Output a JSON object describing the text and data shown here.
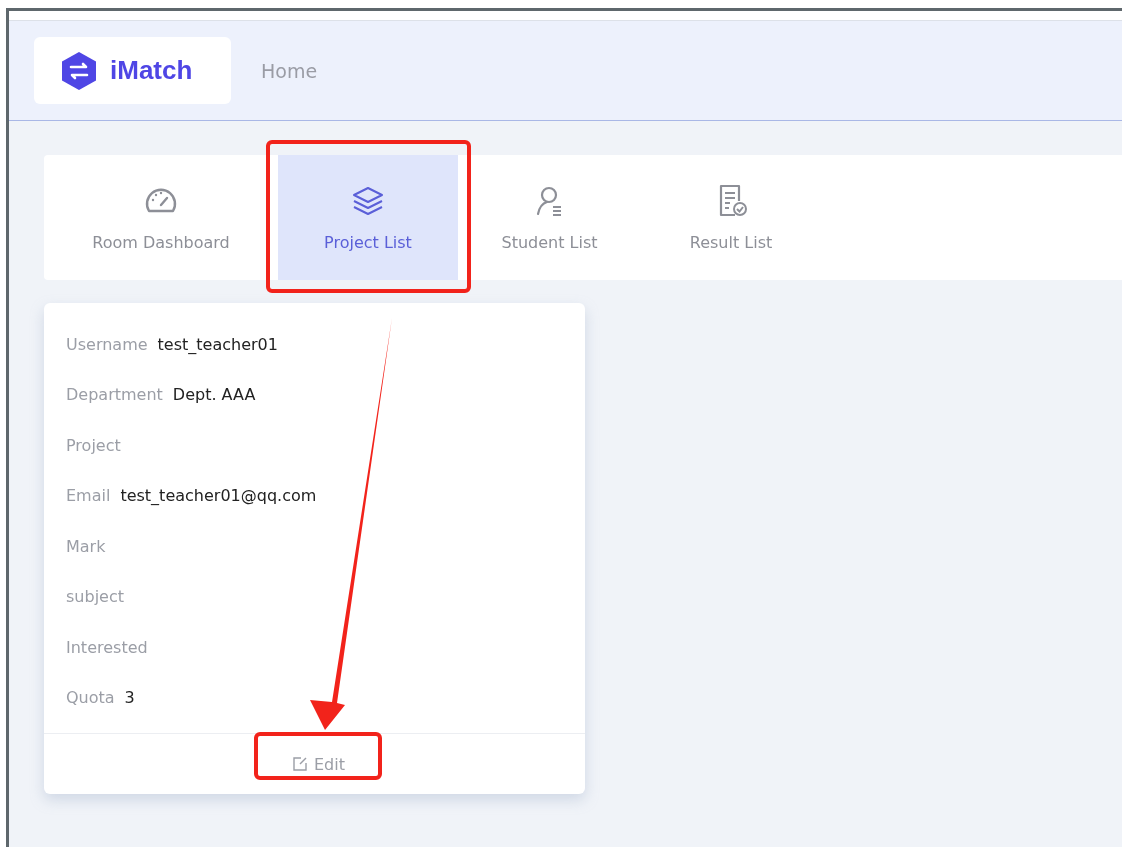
{
  "header": {
    "logo": "iMatch",
    "nav": "Home"
  },
  "tabs": [
    {
      "label": "Room Dashboard",
      "selected": false
    },
    {
      "label": "Project List",
      "selected": true
    },
    {
      "label": "Student List",
      "selected": false
    },
    {
      "label": "Result List",
      "selected": false
    }
  ],
  "profile": {
    "fields": [
      {
        "label": "Username",
        "value": "test_teacher01"
      },
      {
        "label": "Department",
        "value": "Dept. AAA"
      },
      {
        "label": "Project"
      },
      {
        "label": "Email",
        "value": "test_teacher01@qq.com"
      },
      {
        "label": "Mark"
      },
      {
        "label": "subject"
      },
      {
        "label": "Interested"
      },
      {
        "label": "Quota",
        "value": "3"
      }
    ],
    "action": "Edit"
  }
}
